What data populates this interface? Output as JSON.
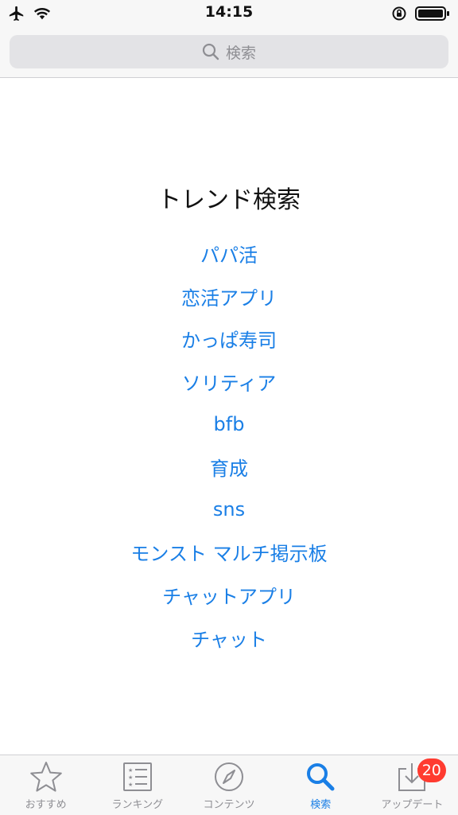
{
  "status_bar": {
    "time": "14:15"
  },
  "search": {
    "placeholder": "検索"
  },
  "trend": {
    "title": "トレンド検索",
    "items": [
      "パパ活",
      "恋活アプリ",
      "かっぱ寿司",
      "ソリティア",
      "bfb",
      "育成",
      "sns",
      "モンスト マルチ掲示板",
      "チャットアプリ",
      "チャット"
    ]
  },
  "tab_bar": {
    "tabs": [
      {
        "label": "おすすめ",
        "icon": "star-icon"
      },
      {
        "label": "ランキング",
        "icon": "list-icon"
      },
      {
        "label": "コンテンツ",
        "icon": "compass-icon"
      },
      {
        "label": "検索",
        "icon": "search-icon",
        "active": true
      },
      {
        "label": "アップデート",
        "icon": "download-tray-icon",
        "badge": "20"
      }
    ]
  },
  "colors": {
    "accent": "#1a7fe6",
    "badge": "#ff3b30",
    "inactive": "#8e8e93"
  }
}
